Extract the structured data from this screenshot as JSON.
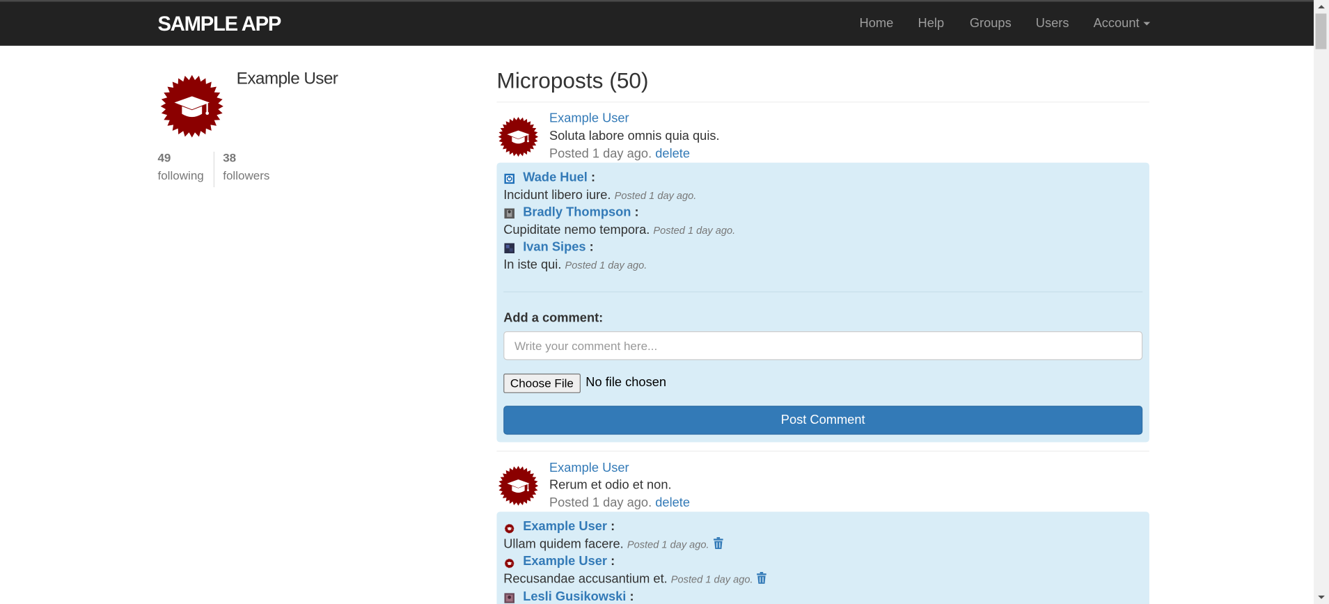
{
  "navbar": {
    "brand": "sample app",
    "links": [
      "Home",
      "Help",
      "Groups",
      "Users"
    ],
    "account": "Account"
  },
  "profile": {
    "name": "Example User",
    "following_count": "49",
    "following_label": "following",
    "followers_count": "38",
    "followers_label": "followers"
  },
  "feed": {
    "title": "Microposts (50)",
    "posts": [
      {
        "user": "Example User",
        "content": "Soluta labore omnis quia quis.",
        "posted": "Posted 1 day ago.",
        "delete": "delete",
        "comments": [
          {
            "author": "Wade Huel",
            "text": "Incidunt libero iure.",
            "time": "Posted 1 day ago."
          },
          {
            "author": "Bradly Thompson",
            "text": "Cupiditate nemo tempora.",
            "time": "Posted 1 day ago."
          },
          {
            "author": "Ivan Sipes",
            "text": "In iste qui.",
            "time": "Posted 1 day ago."
          }
        ],
        "add_comment_label": "Add a comment:",
        "comment_placeholder": "Write your comment here...",
        "choose_file": "Choose File",
        "file_status": "No file chosen",
        "post_button": "Post Comment"
      },
      {
        "user": "Example User",
        "content": "Rerum et odio et non.",
        "posted": "Posted 1 day ago.",
        "delete": "delete",
        "comments": [
          {
            "author": "Example User",
            "text": "Ullam quidem facere.",
            "time": "Posted 1 day ago."
          },
          {
            "author": "Example User",
            "text": "Recusandae accusantium et.",
            "time": "Posted 1 day ago."
          },
          {
            "author": "Lesli Gusikowski",
            "text": "",
            "time": ""
          }
        ]
      }
    ]
  },
  "colors": {
    "navbar_bg": "#222222",
    "link": "#337ab7",
    "comments_bg": "#d9edf7",
    "primary_button": "#337ab7",
    "avatar_badge": "#8b0000"
  },
  "icons": {
    "avatar": "graduation-cap-badge-icon",
    "delete_comment": "trash-icon",
    "account_menu": "caret-down-icon"
  }
}
